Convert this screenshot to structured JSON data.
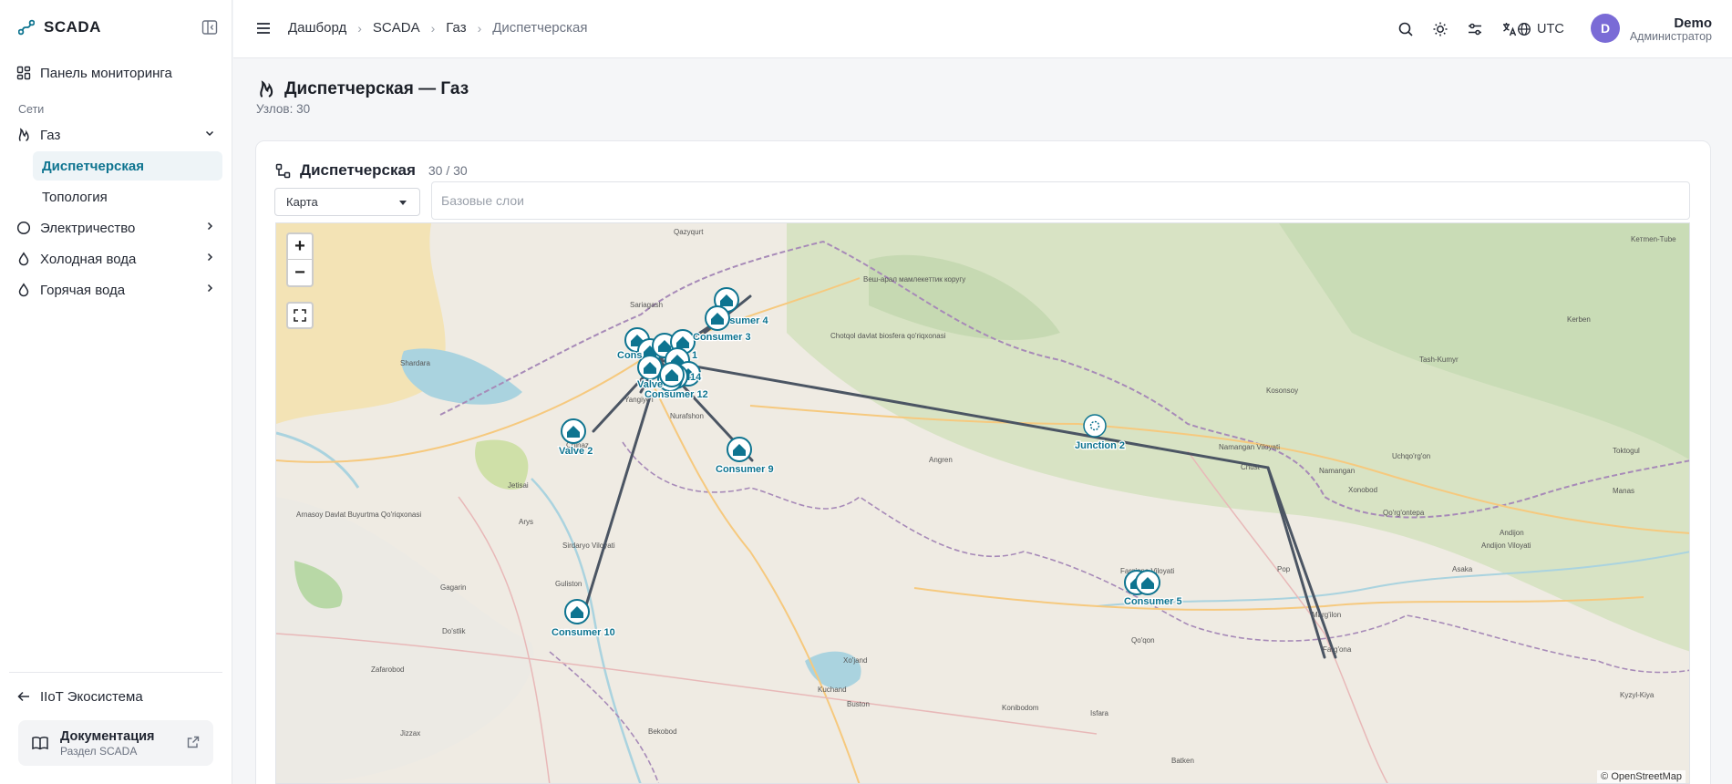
{
  "sidebar": {
    "brand": "SCADA",
    "dashboard_item": "Панель мониторинга",
    "section_label": "Сети",
    "items": [
      {
        "label": "Газ"
      },
      {
        "label": "Электричество"
      },
      {
        "label": "Холодная вода"
      },
      {
        "label": "Горячая вода"
      }
    ],
    "gas_children": [
      {
        "label": "Диспетчерская"
      },
      {
        "label": "Топология"
      }
    ],
    "ecosystem_link": "IIoT Экосистема",
    "docs": {
      "title": "Документация",
      "subtitle": "Раздел SCADA"
    }
  },
  "header": {
    "breadcrumbs": [
      "Дашборд",
      "SCADA",
      "Газ",
      "Диспетчерская"
    ],
    "timezone": "UTC",
    "user": {
      "initial": "D",
      "name": "Demo",
      "role": "Администратор"
    }
  },
  "page": {
    "title": "Диспетчерская — Газ",
    "subtitle": "Узлов: 30"
  },
  "card": {
    "title": "Диспетчерская",
    "count": "30 / 30",
    "view_select": "Карта",
    "layers_placeholder": "Базовые слои"
  },
  "map": {
    "attribution": "© OpenStreetMap",
    "nodes": [
      {
        "label": "Consumer 4"
      },
      {
        "label": "Consumer 3"
      },
      {
        "label": "Valve 2"
      },
      {
        "label": "Consumer 9"
      },
      {
        "label": "Consumer 12"
      },
      {
        "label": "Consumer 10"
      },
      {
        "label": "Junction 2"
      },
      {
        "label": "Consumer 5"
      }
    ],
    "places": [
      "Qazyqurt",
      "Sariagash",
      "Shardara",
      "Chinaz",
      "Yangiyo'l",
      "Nurafshon",
      "Angren",
      "Namangan",
      "Kosonsoy",
      "Chust",
      "Andijon",
      "Asaka",
      "Marg'ilon",
      "Farg'ona",
      "Qo'qon",
      "Isfara",
      "Batken",
      "Xo'jand",
      "Guliston",
      "Jizzax",
      "Bekobod",
      "Zafarobod",
      "Gagarin",
      "Do'stlik",
      "Kerben",
      "Tash-Kumyr",
      "Uchqo'rg'on",
      "Xonobod",
      "Manas",
      "Toktogul",
      "Keтmen-Tube",
      "Sirdaryo Viloyati",
      "Namangan Viloyati",
      "Andijon Viloyati",
      "Farg'ona Viloyati",
      "Chotqol davlat biosfera qo'riqxonasi",
      "Beш-арал мамлекеттик коругу",
      "Arnasoy Davlat Buyurtma Qo'riqxonasi",
      "Jetisai",
      "Arys",
      "Qo'rg'ontepa",
      "Pop",
      "Konibodom",
      "Buston",
      "Kuchand",
      "Kyzyl-Kiya"
    ]
  },
  "colors": {
    "accent": "#0e7490",
    "pipe": "#4b5563",
    "avatar": "#7a6bd6"
  }
}
